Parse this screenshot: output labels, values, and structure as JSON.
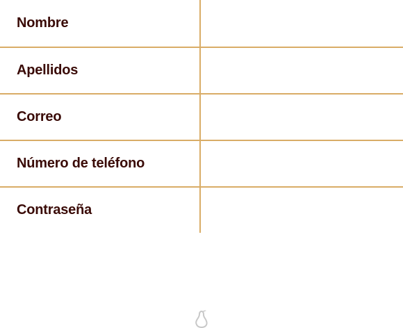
{
  "form": {
    "fields": [
      {
        "label": "Nombre",
        "value": ""
      },
      {
        "label": "Apellidos",
        "value": ""
      },
      {
        "label": "Correo",
        "value": ""
      },
      {
        "label": "Número de teléfono",
        "value": ""
      },
      {
        "label": "Contraseña",
        "value": ""
      }
    ]
  },
  "footer": {
    "icon": "pear-logo-icon"
  },
  "colors": {
    "label_text": "#3a0b07",
    "divider": "#d9ac66",
    "footer_icon": "#c8c8c8"
  }
}
